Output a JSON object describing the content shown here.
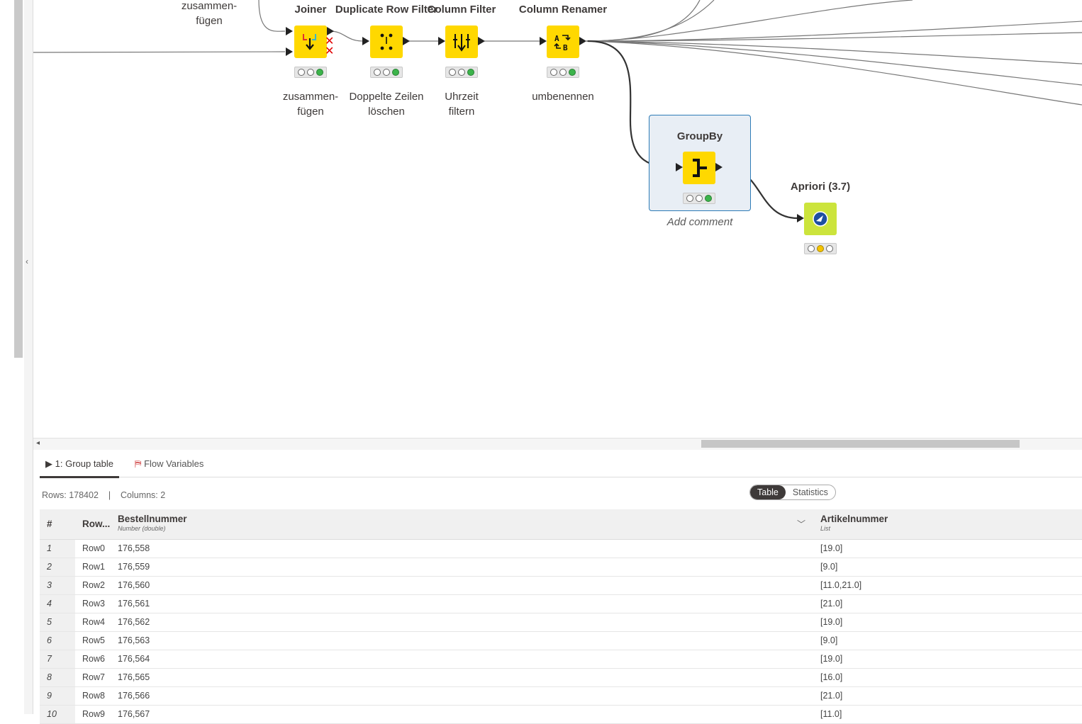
{
  "canvas": {
    "top_left_label": "zusammen-\nfügen",
    "nodes": [
      {
        "title": "Joiner",
        "label": "zusammen-\nfügen"
      },
      {
        "title": "Duplicate Row Filter",
        "label": "Doppelte Zeilen\nlöschen"
      },
      {
        "title": "Column Filter",
        "label": "Uhrzeit\nfiltern"
      },
      {
        "title": "Column Renamer",
        "label": "umbenennen"
      },
      {
        "title": "GroupBy",
        "label": "Add comment"
      },
      {
        "title": "Apriori (3.7)",
        "label": ""
      }
    ]
  },
  "bottom_panel": {
    "tabs": [
      {
        "label": "1: Group table",
        "icon": "play-icon",
        "active": true
      },
      {
        "label": "Flow Variables",
        "icon": "flow-variable-icon",
        "active": false
      }
    ],
    "rows_label": "Rows: 178402",
    "separator": "|",
    "columns_label": "Columns: 2",
    "view_toggle": {
      "table": "Table",
      "statistics": "Statistics"
    },
    "table": {
      "index_header": "#",
      "rowid_header": "Row...",
      "columns": [
        {
          "name": "Bestellnummer",
          "type": "Number (double)"
        },
        {
          "name": "Artikelnummer",
          "type": "List"
        }
      ],
      "rows": [
        {
          "idx": "1",
          "rowid": "Row0",
          "a": "176,558",
          "b": "[19.0]"
        },
        {
          "idx": "2",
          "rowid": "Row1",
          "a": "176,559",
          "b": "[9.0]"
        },
        {
          "idx": "3",
          "rowid": "Row2",
          "a": "176,560",
          "b": "[11.0,21.0]"
        },
        {
          "idx": "4",
          "rowid": "Row3",
          "a": "176,561",
          "b": "[21.0]"
        },
        {
          "idx": "5",
          "rowid": "Row4",
          "a": "176,562",
          "b": "[19.0]"
        },
        {
          "idx": "6",
          "rowid": "Row5",
          "a": "176,563",
          "b": "[9.0]"
        },
        {
          "idx": "7",
          "rowid": "Row6",
          "a": "176,564",
          "b": "[19.0]"
        },
        {
          "idx": "8",
          "rowid": "Row7",
          "a": "176,565",
          "b": "[16.0]"
        },
        {
          "idx": "9",
          "rowid": "Row8",
          "a": "176,566",
          "b": "[21.0]"
        },
        {
          "idx": "10",
          "rowid": "Row9",
          "a": "176,567",
          "b": "[11.0]"
        }
      ]
    }
  }
}
